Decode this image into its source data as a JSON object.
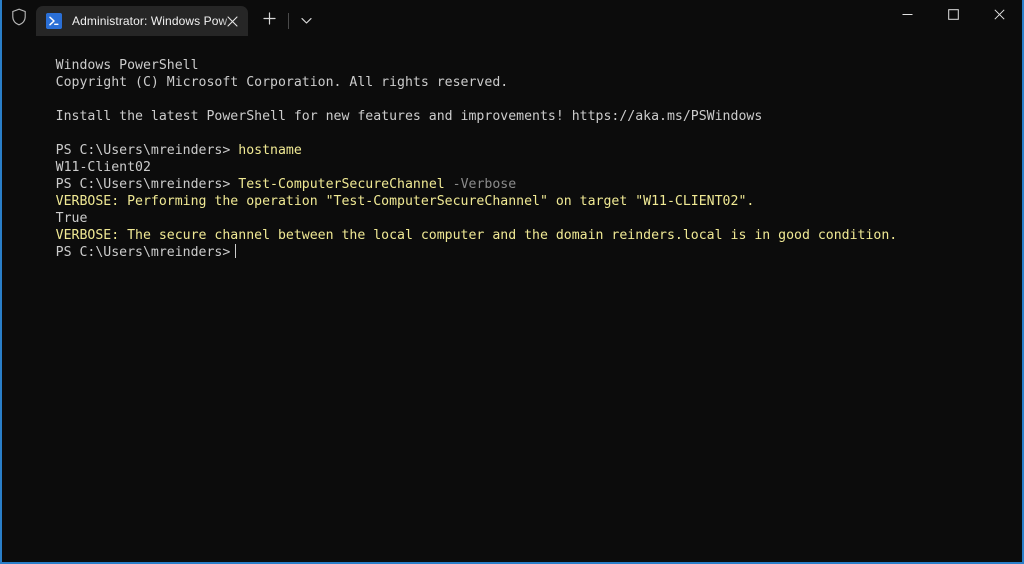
{
  "window": {
    "accent_color": "#2a7fc9",
    "background": "#0c0c0c",
    "titlebar_background": "#0c0c0c"
  },
  "titlebar": {
    "shield_icon": "shield-icon",
    "tabs": [
      {
        "icon": "powershell-icon",
        "title": "Administrator: Windows Pow",
        "full_title": "Administrator: Windows PowerShell",
        "active": true,
        "close_icon": "close-icon"
      }
    ],
    "new_tab_icon": "plus-icon",
    "tab_menu_icon": "chevron-down-icon",
    "caption": {
      "minimize_icon": "minimize-icon",
      "maximize_icon": "maximize-icon",
      "close_icon": "close-icon"
    }
  },
  "terminal": {
    "colors": {
      "foreground": "#cccccc",
      "yellow": "#f0e994",
      "dim": "#8b8b8b",
      "background": "#0c0c0c"
    },
    "lines": [
      {
        "id": "l0",
        "text": "Windows PowerShell",
        "color": "white"
      },
      {
        "id": "l1",
        "text": "Copyright (C) Microsoft Corporation. All rights reserved.",
        "color": "white"
      },
      {
        "id": "l2",
        "text": "",
        "color": "white"
      },
      {
        "id": "l3",
        "text": "Install the latest PowerShell for new features and improvements! https://aka.ms/PSWindows",
        "color": "white"
      },
      {
        "id": "l4",
        "text": "",
        "color": "white"
      },
      {
        "id": "l5",
        "prompt": "PS C:\\Users\\mreinders> ",
        "command": "hostname",
        "type": "prompt"
      },
      {
        "id": "l6",
        "text": "W11-Client02",
        "color": "white"
      },
      {
        "id": "l7",
        "prompt": "PS C:\\Users\\mreinders> ",
        "command": "Test-ComputerSecureChannel ",
        "param": "-Verbose",
        "type": "prompt"
      },
      {
        "id": "l8",
        "text": "VERBOSE: Performing the operation \"Test-ComputerSecureChannel\" on target \"W11-CLIENT02\".",
        "color": "yellow"
      },
      {
        "id": "l9",
        "text": "True",
        "color": "white"
      },
      {
        "id": "l10",
        "text": "VERBOSE: The secure channel between the local computer and the domain reinders.local is in good condition.",
        "color": "yellow"
      },
      {
        "id": "l11",
        "prompt": "PS C:\\Users\\mreinders>",
        "command": "",
        "type": "prompt-cursor"
      }
    ]
  }
}
